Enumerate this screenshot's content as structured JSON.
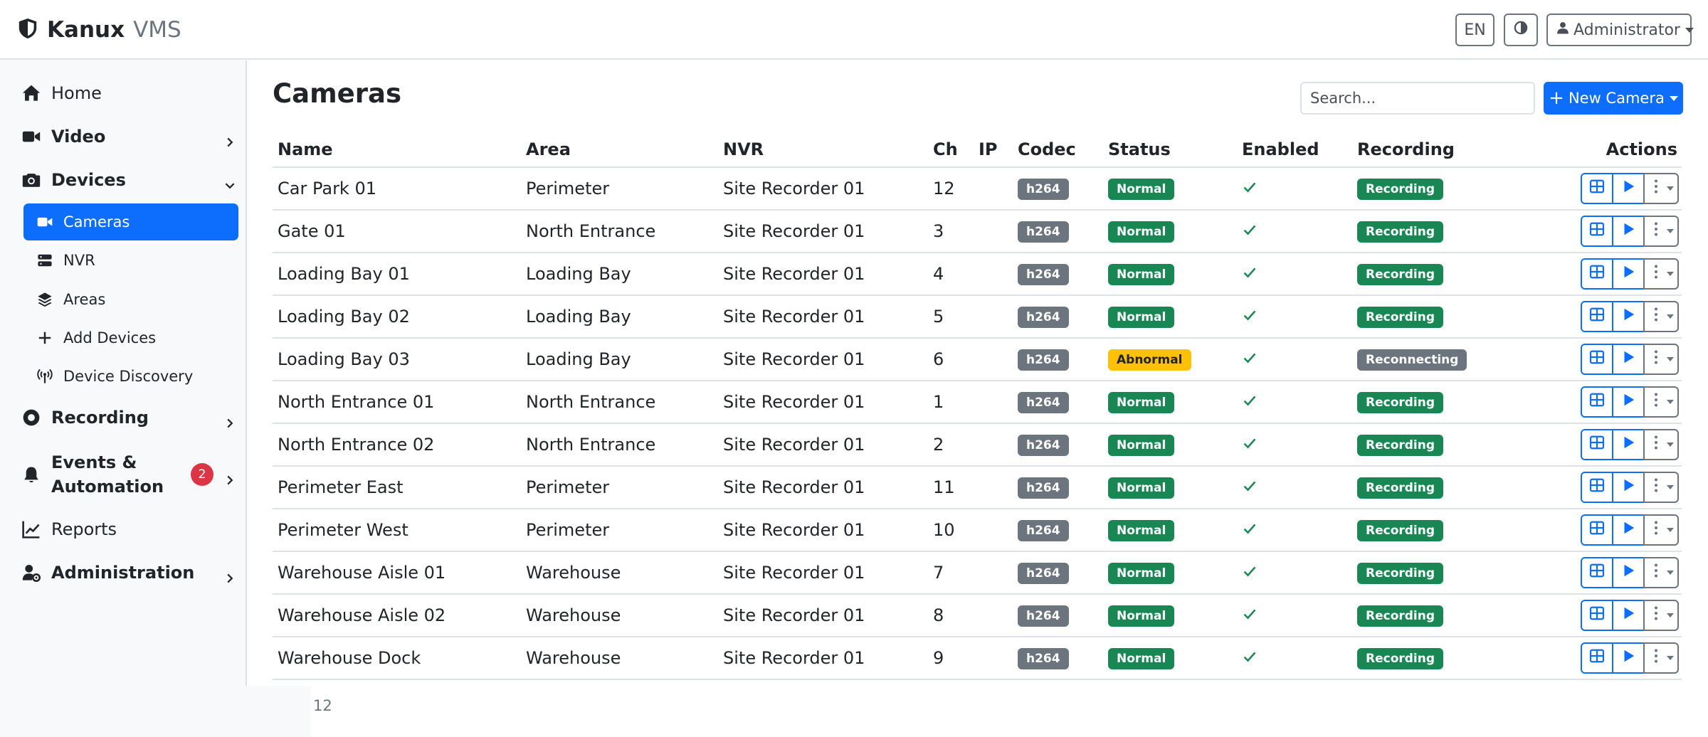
{
  "app": {
    "brand_name": "Kanux",
    "brand_suffix": "VMS"
  },
  "topbar": {
    "language": "EN",
    "user": "Administrator"
  },
  "sidebar": {
    "home": "Home",
    "video": "Video",
    "devices": "Devices",
    "sub": {
      "cameras": "Cameras",
      "nvr": "NVR",
      "areas": "Areas",
      "add_devices": "Add Devices",
      "device_discovery": "Device Discovery"
    },
    "recording": "Recording",
    "events_line1": "Events &",
    "events_line2": "Automation",
    "events_badge": "2",
    "reports": "Reports",
    "administration": "Administration"
  },
  "main": {
    "title": "Cameras",
    "search_placeholder": "Search...",
    "new_button": "New Camera",
    "columns": {
      "name": "Name",
      "area": "Area",
      "nvr": "NVR",
      "ch": "Ch",
      "ip": "IP",
      "codec": "Codec",
      "status": "Status",
      "enabled": "Enabled",
      "recording": "Recording",
      "actions": "Actions"
    },
    "rows": [
      {
        "name": "Car Park 01",
        "area": "Perimeter",
        "nvr": "Site Recorder 01",
        "ch": "12",
        "ip": "",
        "codec": "h264",
        "status": "Normal",
        "enabled": true,
        "recording": "Recording"
      },
      {
        "name": "Gate 01",
        "area": "North Entrance",
        "nvr": "Site Recorder 01",
        "ch": "3",
        "ip": "",
        "codec": "h264",
        "status": "Normal",
        "enabled": true,
        "recording": "Recording"
      },
      {
        "name": "Loading Bay 01",
        "area": "Loading Bay",
        "nvr": "Site Recorder 01",
        "ch": "4",
        "ip": "",
        "codec": "h264",
        "status": "Normal",
        "enabled": true,
        "recording": "Recording"
      },
      {
        "name": "Loading Bay 02",
        "area": "Loading Bay",
        "nvr": "Site Recorder 01",
        "ch": "5",
        "ip": "",
        "codec": "h264",
        "status": "Normal",
        "enabled": true,
        "recording": "Recording"
      },
      {
        "name": "Loading Bay 03",
        "area": "Loading Bay",
        "nvr": "Site Recorder 01",
        "ch": "6",
        "ip": "",
        "codec": "h264",
        "status": "Abnormal",
        "enabled": true,
        "recording": "Reconnecting"
      },
      {
        "name": "North Entrance 01",
        "area": "North Entrance",
        "nvr": "Site Recorder 01",
        "ch": "1",
        "ip": "",
        "codec": "h264",
        "status": "Normal",
        "enabled": true,
        "recording": "Recording"
      },
      {
        "name": "North Entrance 02",
        "area": "North Entrance",
        "nvr": "Site Recorder 01",
        "ch": "2",
        "ip": "",
        "codec": "h264",
        "status": "Normal",
        "enabled": true,
        "recording": "Recording"
      },
      {
        "name": "Perimeter East",
        "area": "Perimeter",
        "nvr": "Site Recorder 01",
        "ch": "11",
        "ip": "",
        "codec": "h264",
        "status": "Normal",
        "enabled": true,
        "recording": "Recording"
      },
      {
        "name": "Perimeter West",
        "area": "Perimeter",
        "nvr": "Site Recorder 01",
        "ch": "10",
        "ip": "",
        "codec": "h264",
        "status": "Normal",
        "enabled": true,
        "recording": "Recording"
      },
      {
        "name": "Warehouse Aisle 01",
        "area": "Warehouse",
        "nvr": "Site Recorder 01",
        "ch": "7",
        "ip": "",
        "codec": "h264",
        "status": "Normal",
        "enabled": true,
        "recording": "Recording"
      },
      {
        "name": "Warehouse Aisle 02",
        "area": "Warehouse",
        "nvr": "Site Recorder 01",
        "ch": "8",
        "ip": "",
        "codec": "h264",
        "status": "Normal",
        "enabled": true,
        "recording": "Recording"
      },
      {
        "name": "Warehouse Dock",
        "area": "Warehouse",
        "nvr": "Site Recorder 01",
        "ch": "9",
        "ip": "",
        "codec": "h264",
        "status": "Normal",
        "enabled": true,
        "recording": "Recording"
      }
    ],
    "total_count": "12"
  },
  "colors": {
    "primary": "#0d6efd",
    "success": "#198754",
    "warning": "#ffc107",
    "secondary": "#6c757d",
    "danger": "#dc3545"
  },
  "icons": {
    "brand": "shield-icon",
    "theme": "contrast-icon",
    "user": "person-icon",
    "home": "house-icon",
    "video": "video-camera-icon",
    "devices": "camera-icon",
    "cameras": "video-camera-icon",
    "nvr": "server-icon",
    "areas": "layers-icon",
    "add_devices": "plus-icon",
    "device_discovery": "broadcast-icon",
    "recording": "record-icon",
    "events": "bell-icon",
    "reports": "line-chart-icon",
    "administration": "user-gear-icon",
    "row_actions": [
      "grid-view-icon",
      "play-icon",
      "kebab-menu-icon"
    ]
  }
}
